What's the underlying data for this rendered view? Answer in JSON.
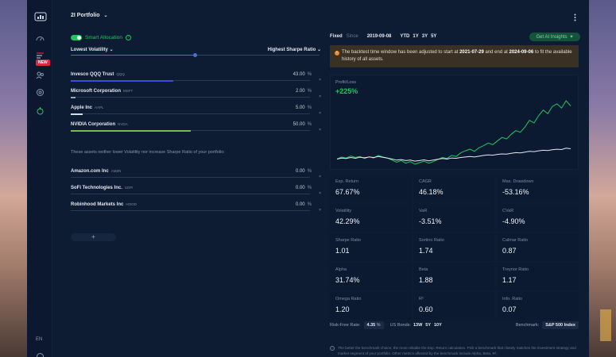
{
  "header": {
    "portfolio_title": "2I Portfolio"
  },
  "rail": {
    "new_badge": "NEW",
    "language": "EN"
  },
  "smart_allocation": {
    "label": "Smart Allocation",
    "enabled": true,
    "slider_left": "Lowest Volatility",
    "slider_right": "Highest Sharpe Ratio",
    "slider_position_pct": 50
  },
  "assets": [
    {
      "name": "Invesco QQQ Trust",
      "ticker": "QQQ",
      "weight_label": "43.00",
      "weight": 43,
      "color": "#3b4fd8"
    },
    {
      "name": "Microsoft Corporation",
      "ticker": "MSFT",
      "weight_label": "2.00",
      "weight": 2,
      "color": "#9aa6bb"
    },
    {
      "name": "Apple Inc",
      "ticker": "AAPL",
      "weight_label": "5.00",
      "weight": 5,
      "color": "#d6dbe6"
    },
    {
      "name": "NVIDIA Corporation",
      "ticker": "NVDA",
      "weight_label": "50.00",
      "weight": 50,
      "color": "#76c043"
    }
  ],
  "excluded_note": "These assets neither lower Volatility nor increase Sharpe Ratio of your portfolio:",
  "excluded_assets": [
    {
      "name": "Amazon.com Inc",
      "ticker": "AMZN",
      "weight_label": "0.00"
    },
    {
      "name": "SoFi Technologies Inc.",
      "ticker": "SOFI",
      "weight_label": "0.00"
    },
    {
      "name": "Robinhood Markets Inc",
      "ticker": "HOOD",
      "weight_label": "0.00"
    }
  ],
  "percent_sign": "%",
  "remove_glyph": "×",
  "add_glyph": "+",
  "range": {
    "fixed": "Fixed",
    "since": "Since",
    "date": "2019-09-08",
    "periods": [
      "YTD",
      "1Y",
      "3Y",
      "5Y"
    ]
  },
  "ai_button": "Get AI Insights",
  "warning": {
    "prefix": "The backtest time window has been adjusted to start at ",
    "start": "2021-07-29",
    "mid": " and end at ",
    "end": "2024-09-06",
    "suffix": " to fit the available history of all assets."
  },
  "chart_data": {
    "type": "line",
    "title": "Profit/Loss",
    "headline": "+225%",
    "series": [
      {
        "color": "#22c55e",
        "values": [
          0,
          8,
          4,
          12,
          6,
          10,
          2,
          9,
          4,
          14,
          8,
          4,
          -4,
          -12,
          -6,
          -16,
          -10,
          -20,
          -14,
          -8,
          -16,
          -10,
          -2,
          6,
          2,
          14,
          10,
          24,
          32,
          38,
          30,
          44,
          52,
          62,
          56,
          70,
          84,
          78,
          96,
          110,
          104,
          124,
          150,
          140,
          168,
          190,
          176,
          204,
          214,
          198,
          226,
          206
        ]
      },
      {
        "color": "#e4e8f0",
        "values": [
          0,
          4,
          2,
          6,
          3,
          7,
          5,
          8,
          6,
          10,
          7,
          4,
          0,
          -4,
          -2,
          -6,
          -4,
          -8,
          -6,
          -3,
          -7,
          -4,
          -1,
          2,
          0,
          4,
          3,
          6,
          8,
          10,
          8,
          11,
          14,
          16,
          15,
          18,
          20,
          19,
          22,
          25,
          24,
          27,
          30,
          29,
          32,
          34,
          33,
          36,
          38,
          37,
          42,
          40
        ]
      }
    ]
  },
  "metrics": [
    {
      "label": "Exp. Return",
      "value": "67.67%"
    },
    {
      "label": "CAGR",
      "value": "46.18%"
    },
    {
      "label": "Max. Drawdown",
      "value": "-53.16%"
    },
    {
      "label": "Volatility",
      "value": "42.29%"
    },
    {
      "label": "VaR",
      "value": "-3.51%"
    },
    {
      "label": "CVaR",
      "value": "-4.90%"
    },
    {
      "label": "Sharpe Ratio",
      "value": "1.01"
    },
    {
      "label": "Sortino Ratio",
      "value": "1.74"
    },
    {
      "label": "Calmar Ratio",
      "value": "0.87"
    },
    {
      "label": "Alpha",
      "value": "31.74%"
    },
    {
      "label": "Beta",
      "value": "1.88"
    },
    {
      "label": "Treynor Ratio",
      "value": "1.17"
    },
    {
      "label": "Omega Ratio",
      "value": "1.20"
    },
    {
      "label": "R²",
      "value": "0.60"
    },
    {
      "label": "Info. Ratio",
      "value": "0.07"
    }
  ],
  "footer": {
    "rf_label": "Risk-Free Rate:",
    "rf_value": "4.35",
    "rf_unit": "%",
    "bonds_label": "US Bonds:",
    "bonds": [
      "13W",
      "5Y",
      "10Y"
    ],
    "bench_label": "Benchmark:",
    "bench_value": "S&P 500 Index"
  },
  "disclaimer": "The better the benchmark choice, the more reliable the Exp. Return calculation. Pick a benchmark that closely matches the investment strategy and market segment of your portfolio. Other metrics affected by the benchmark include Alpha, Beta, R²,"
}
